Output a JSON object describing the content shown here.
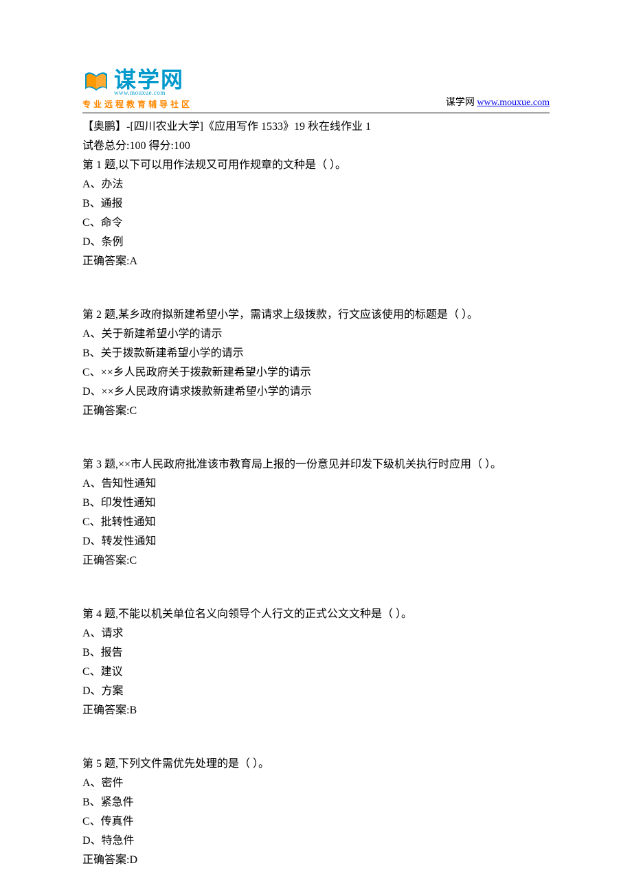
{
  "header": {
    "logo_text": "谋学网",
    "logo_url": "www.mouxue.com",
    "tagline": "专业远程教育辅导社区",
    "site_name": "谋学网 ",
    "site_url": "www.mouxue.com"
  },
  "document": {
    "title": "【奥鹏】-[四川农业大学]《应用写作 1533》19 秋在线作业 1",
    "score_line": "试卷总分:100    得分:100"
  },
  "questions": [
    {
      "prompt": "第 1 题,以下可以用作法规又可用作规章的文种是（    ）。",
      "options": [
        "A、办法",
        "B、通报",
        "C、命令",
        "D、条例"
      ],
      "answer": "正确答案:A"
    },
    {
      "prompt": "第 2 题,某乡政府拟新建希望小学，需请求上级拨款，行文应该使用的标题是（     ）。",
      "options": [
        "A、关于新建希望小学的请示",
        "B、关于拨款新建希望小学的请示",
        "C、××乡人民政府关于拨款新建希望小学的请示",
        "D、××乡人民政府请求拨款新建希望小学的请示"
      ],
      "answer": "正确答案:C"
    },
    {
      "prompt": "第 3 题,××市人民政府批准该市教育局上报的一份意见并印发下级机关执行时应用（    ）。",
      "options": [
        "A、告知性通知",
        "B、印发性通知",
        "C、批转性通知",
        "D、转发性通知"
      ],
      "answer": "正确答案:C"
    },
    {
      "prompt": "第 4 题,不能以机关单位名义向领导个人行文的正式公文文种是（       ）。",
      "options": [
        "A、请求",
        "B、报告",
        "C、建议",
        "D、方案"
      ],
      "answer": "正确答案:B"
    },
    {
      "prompt": "第 5 题,下列文件需优先处理的是（    ）。",
      "options": [
        "A、密件",
        "B、紧急件",
        "C、传真件",
        "D、特急件"
      ],
      "answer": "正确答案:D"
    }
  ]
}
